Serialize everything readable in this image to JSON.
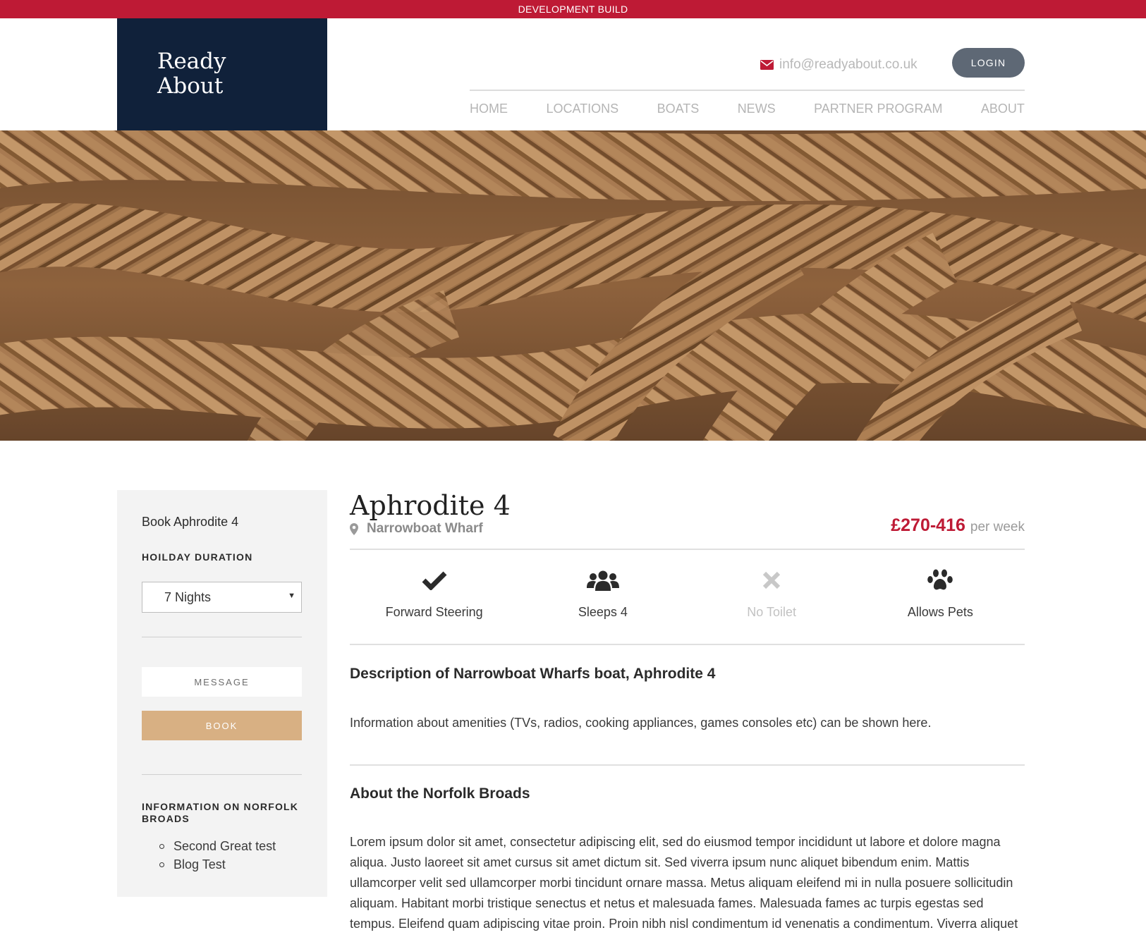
{
  "banner": {
    "text": "DEVELOPMENT BUILD"
  },
  "brand": {
    "line1": "Ready",
    "line2": "About"
  },
  "header": {
    "email": "info@readyabout.co.uk",
    "login_label": "LOGIN",
    "accent_color": "#be1a35",
    "nav": [
      "HOME",
      "LOCATIONS",
      "BOATS",
      "NEWS",
      "PARTNER PROGRAM",
      "ABOUT"
    ]
  },
  "sidebar": {
    "title": "Book Aphrodite 4",
    "duration_label": "HOILDAY DURATION",
    "duration_value": "7 Nights",
    "message_label": "MESSAGE",
    "book_label": "BOOK",
    "info_label": "INFORMATION ON NORFOLK BROADS",
    "info_links": [
      "Second Great test",
      "Blog Test"
    ]
  },
  "boat": {
    "name": "Aphrodite 4",
    "location": "Narrowboat Wharf",
    "price": "£270-416",
    "price_unit": "per week",
    "features": [
      {
        "icon": "check-icon",
        "label": "Forward Steering",
        "enabled": true
      },
      {
        "icon": "users-icon",
        "label": "Sleeps 4",
        "enabled": true
      },
      {
        "icon": "times-icon",
        "label": "No Toilet",
        "enabled": false
      },
      {
        "icon": "paw-icon",
        "label": "Allows Pets",
        "enabled": true
      }
    ]
  },
  "description": {
    "heading": "Description of Narrowboat Wharfs boat, Aphrodite 4",
    "text": "Information about amenities (TVs, radios, cooking appliances, games consoles etc) can be shown here."
  },
  "about": {
    "heading": "About the Norfolk Broads",
    "text": "Lorem ipsum dolor sit amet, consectetur adipiscing elit, sed do eiusmod tempor incididunt ut labore et dolore magna aliqua. Justo laoreet sit amet cursus sit amet dictum sit. Sed viverra ipsum nunc aliquet bibendum enim. Mattis ullamcorper velit sed ullamcorper morbi tincidunt ornare massa. Metus aliquam eleifend mi in nulla posuere sollicitudin aliquam. Habitant morbi tristique senectus et netus et malesuada fames. Malesuada fames ac turpis egestas sed tempus. Eleifend quam adipiscing vitae proin. Proin nibh nisl condimentum id venenatis a condimentum. Viverra aliquet eget sit amet. Dictum at tempor commodo ullamcorper. Gravida quis blandit turpis"
  }
}
